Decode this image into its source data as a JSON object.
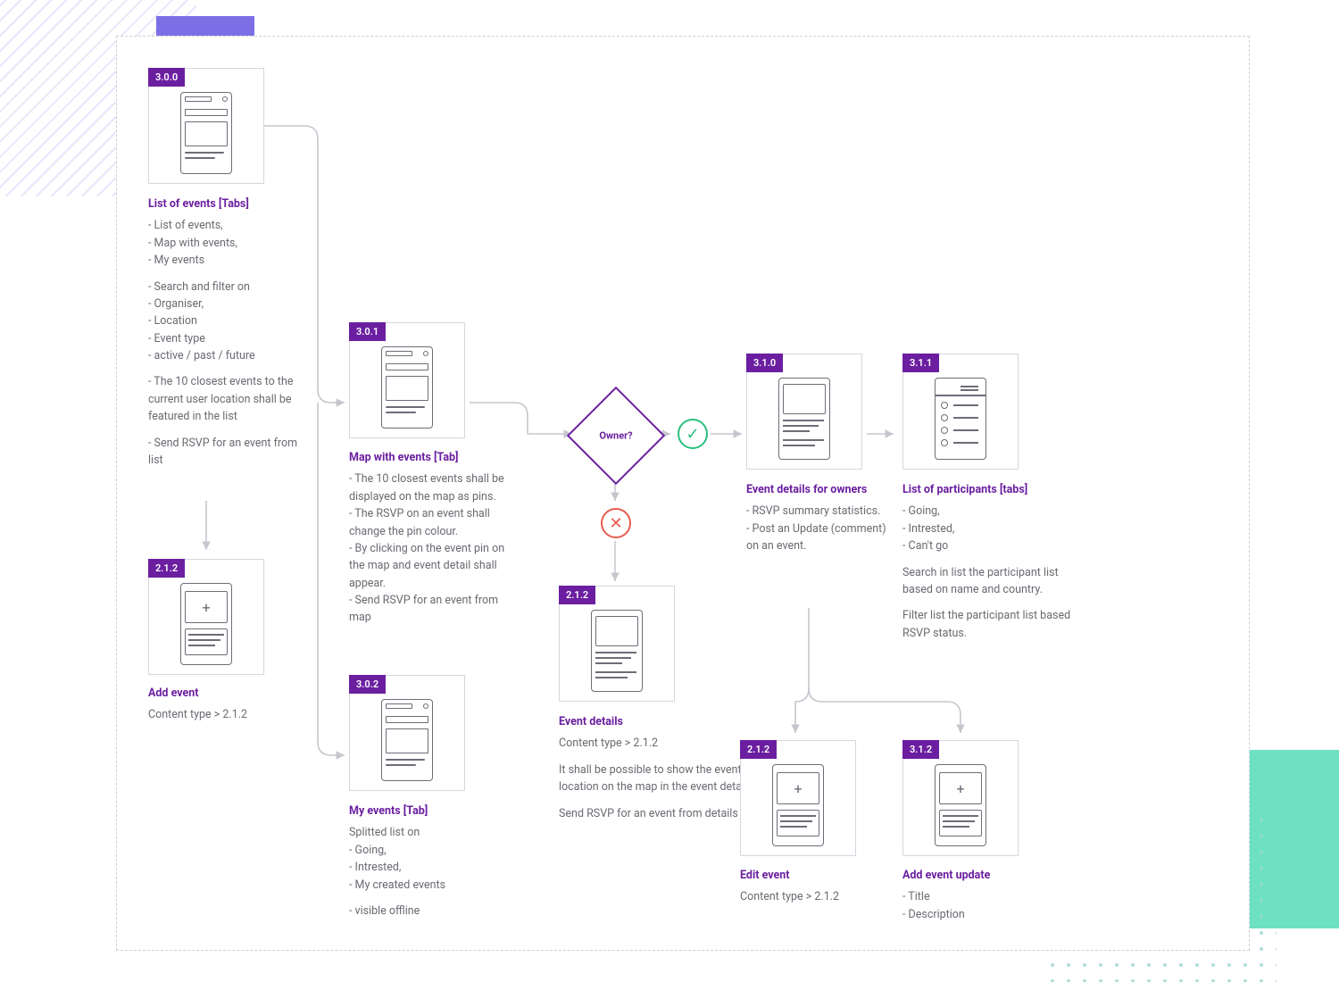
{
  "decision": {
    "label": "Owner?"
  },
  "nodes": {
    "n300": {
      "badge": "3.0.0",
      "title": "List of events [Tabs]",
      "lines": [
        "- List of events,",
        "- Map with events,",
        "- My events",
        "",
        "- Search and filter on",
        "- Organiser,",
        "- Location",
        "- Event type",
        "- active / past / future",
        "",
        "- The 10 closest events to the current user location shall be featured in the list",
        "",
        "- Send RSVP for an event from list"
      ]
    },
    "n212a": {
      "badge": "2.1.2",
      "title": "Add event",
      "lines": [
        "Content type > 2.1.2"
      ]
    },
    "n301": {
      "badge": "3.0.1",
      "title": "Map with events [Tab]",
      "lines": [
        "- The 10 closest events shall be displayed on the map as pins.",
        "- The RSVP on an event shall change the pin colour.",
        "- By clicking on the event pin on the map and event detail shall appear.",
        "- Send RSVP for an event from map"
      ]
    },
    "n302": {
      "badge": "3.0.2",
      "title": "My events [Tab]",
      "lines": [
        "Splitted list on",
        "- Going,",
        "- Intrested,",
        "- My created events",
        "",
        "- visible offline"
      ]
    },
    "n212b": {
      "badge": "2.1.2",
      "title": "Event details",
      "lines": [
        "Content type > 2.1.2",
        "",
        "It shall be possible to show the event location on the map in the event detail.",
        "",
        "Send RSVP for an event from details"
      ]
    },
    "n310": {
      "badge": "3.1.0",
      "title": "Event details for owners",
      "lines": [
        "- RSVP summary statistics.",
        "- Post an Update (comment) on an event."
      ]
    },
    "n311": {
      "badge": "3.1.1",
      "title": "List of participants [tabs]",
      "lines": [
        "- Going,",
        "- Intrested,",
        "- Can't go",
        "",
        "Search in list the participant list based on name and country.",
        "",
        "Filter list the participant list based RSVP status."
      ]
    },
    "n212c": {
      "badge": "2.1.2",
      "title": "Edit event",
      "lines": [
        "Content type > 2.1.2"
      ]
    },
    "n312": {
      "badge": "3.1.2",
      "title": "Add event update",
      "lines": [
        "- Title",
        "- Description"
      ]
    }
  }
}
